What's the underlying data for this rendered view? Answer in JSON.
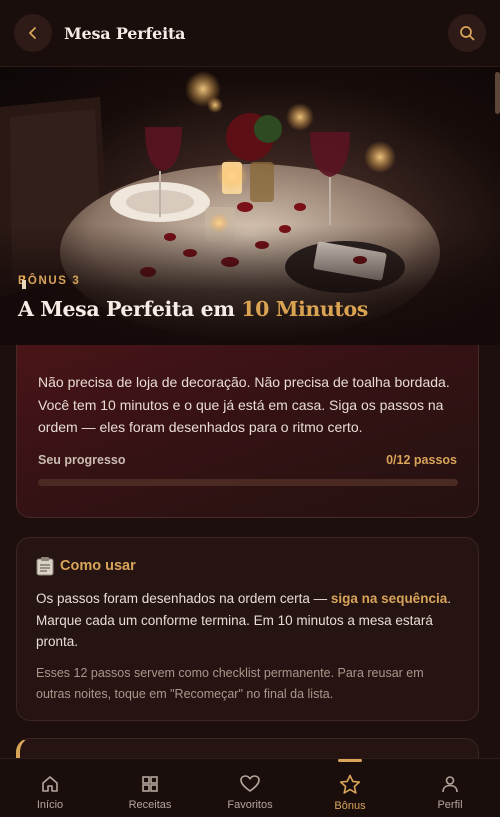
{
  "header": {
    "title": "Mesa Perfeita",
    "back_icon": "chevron-left-icon",
    "search_icon": "search-icon"
  },
  "hero": {
    "kicker": "BÔNUS 3",
    "kicker_icon": "candle-icon",
    "title_main": "A Mesa Perfeita em ",
    "title_accent": "10 Minutos"
  },
  "intro": {
    "text": "Não precisa de loja de decoração. Não precisa de toalha bordada. Você tem 10 minutos e o que já está em casa. Siga os passos na ordem — eles foram desenhados para o ritmo certo.",
    "progress_label": "Seu progresso",
    "progress_count": "0/12 passos",
    "progress_fraction": 0
  },
  "howto": {
    "icon": "clipboard-icon",
    "title": "Como usar",
    "text_before": "Os passos foram desenhados na ordem certa — ",
    "text_highlight": "siga na sequência",
    "text_after": ". Marque cada um conforme termina. Em 10 minutos a mesa estará pronta.",
    "note": "Esses 12 passos servem como checklist permanente. Para reusar em outras noites, toque em \"Recomeçar\" no final da lista."
  },
  "nav": {
    "items": [
      {
        "label": "Início",
        "icon": "home-icon"
      },
      {
        "label": "Receitas",
        "icon": "grid-icon"
      },
      {
        "label": "Favoritos",
        "icon": "heart-icon"
      },
      {
        "label": "Bônus",
        "icon": "star-icon"
      },
      {
        "label": "Perfil",
        "icon": "user-icon"
      }
    ],
    "active": "Bônus"
  },
  "colors": {
    "accent": "#d8a45a",
    "background": "#1c0f0e",
    "card": "#251412",
    "intro_card": "#3a1214"
  }
}
